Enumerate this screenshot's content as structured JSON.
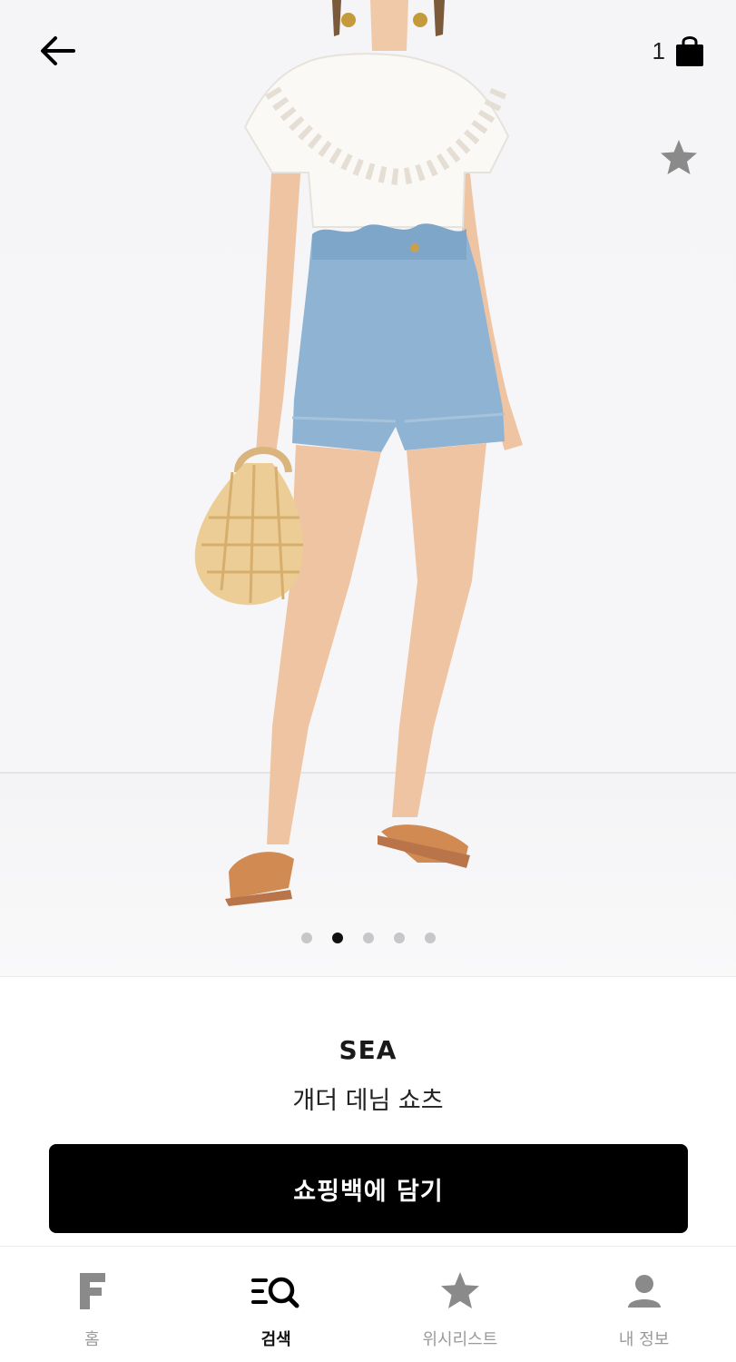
{
  "header": {
    "back_icon": "arrow-left-icon",
    "bag_icon": "shopping-bag-icon",
    "bag_count": "1",
    "wishlist_icon": "star-icon"
  },
  "gallery": {
    "image_description": "Model wearing white eyelet lace top, light blue paperbag denim shorts with scalloped hem, tan slide sandals, holding a wicker basket bag",
    "pagination": {
      "total": 5,
      "active_index": 1
    }
  },
  "product": {
    "brand": "SEA",
    "name": "개더 데님 쇼츠"
  },
  "actions": {
    "add_to_bag_label": "쇼핑백에 담기"
  },
  "tabbar": {
    "items": [
      {
        "label": "홈",
        "icon": "logo-f-icon",
        "active": false
      },
      {
        "label": "검색",
        "icon": "search-icon",
        "active": true
      },
      {
        "label": "위시리스트",
        "icon": "star-icon",
        "active": false
      },
      {
        "label": "내 정보",
        "icon": "user-icon",
        "active": false
      }
    ]
  },
  "colors": {
    "accent": "#000000",
    "inactive": "#9a9a9a",
    "icon_gray": "#8a8a8a",
    "dot_inactive": "#c7c7c9"
  }
}
